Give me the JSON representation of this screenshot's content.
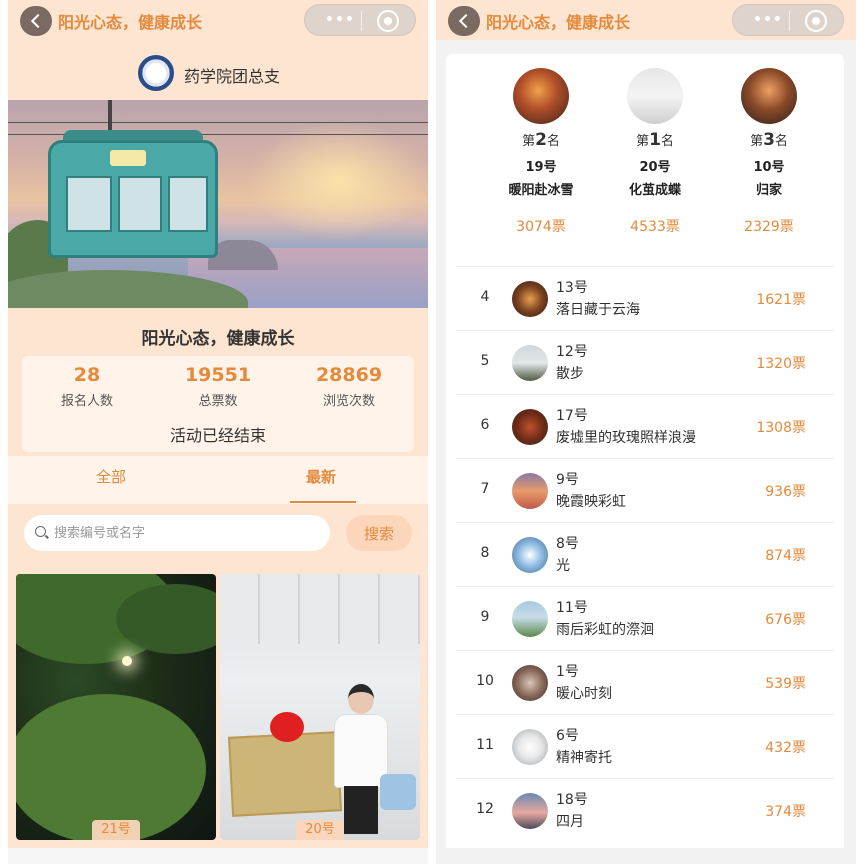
{
  "left": {
    "nav": {
      "title": "阳光心态，健康成长",
      "more_label": "•••"
    },
    "org": {
      "name": "药学院团总支"
    },
    "activity": {
      "title": "阳光心态，健康成长",
      "stats": [
        {
          "value": "28",
          "label": "报名人数"
        },
        {
          "value": "19551",
          "label": "总票数"
        },
        {
          "value": "28869",
          "label": "浏览次数"
        }
      ],
      "status": "活动已经结束"
    },
    "tabs": [
      {
        "label": "全部",
        "active": false
      },
      {
        "label": "最新",
        "active": true
      }
    ],
    "search": {
      "placeholder": "搜索编号或名字",
      "button_label": "搜索"
    },
    "entries": [
      {
        "number": "21号"
      },
      {
        "number": "20号"
      }
    ]
  },
  "right": {
    "nav": {
      "title": "阳光心态，健康成长",
      "more_label": "•••"
    },
    "podium": [
      {
        "rank_prefix": "第",
        "rank": "2",
        "rank_suffix": "名",
        "number": "19号",
        "name": "暖阳赴冰雪",
        "votes": "3074票"
      },
      {
        "rank_prefix": "第",
        "rank": "1",
        "rank_suffix": "名",
        "number": "20号",
        "name": "化茧成蝶",
        "votes": "4533票"
      },
      {
        "rank_prefix": "第",
        "rank": "3",
        "rank_suffix": "名",
        "number": "10号",
        "name": "归家",
        "votes": "2329票"
      }
    ],
    "ranking": [
      {
        "pos": "4",
        "number": "13号",
        "name": "落日藏于云海",
        "votes": "1621票"
      },
      {
        "pos": "5",
        "number": "12号",
        "name": "散步",
        "votes": "1320票"
      },
      {
        "pos": "6",
        "number": "17号",
        "name": "废墟里的玫瑰照样浪漫",
        "votes": "1308票"
      },
      {
        "pos": "7",
        "number": "9号",
        "name": "晚霞映彩虹",
        "votes": "936票"
      },
      {
        "pos": "8",
        "number": "8号",
        "name": "光",
        "votes": "874票"
      },
      {
        "pos": "9",
        "number": "11号",
        "name": "雨后彩虹的漈洄",
        "votes": "676票"
      },
      {
        "pos": "10",
        "number": "1号",
        "name": "暖心时刻",
        "votes": "539票"
      },
      {
        "pos": "11",
        "number": "6号",
        "name": "精神寄托",
        "votes": "432票"
      },
      {
        "pos": "12",
        "number": "18号",
        "name": "四月",
        "votes": "374票"
      }
    ]
  },
  "colors": {
    "accent": "#e48a3c",
    "left_bg": "#fde5d1",
    "right_bg": "#f2f2f2"
  }
}
